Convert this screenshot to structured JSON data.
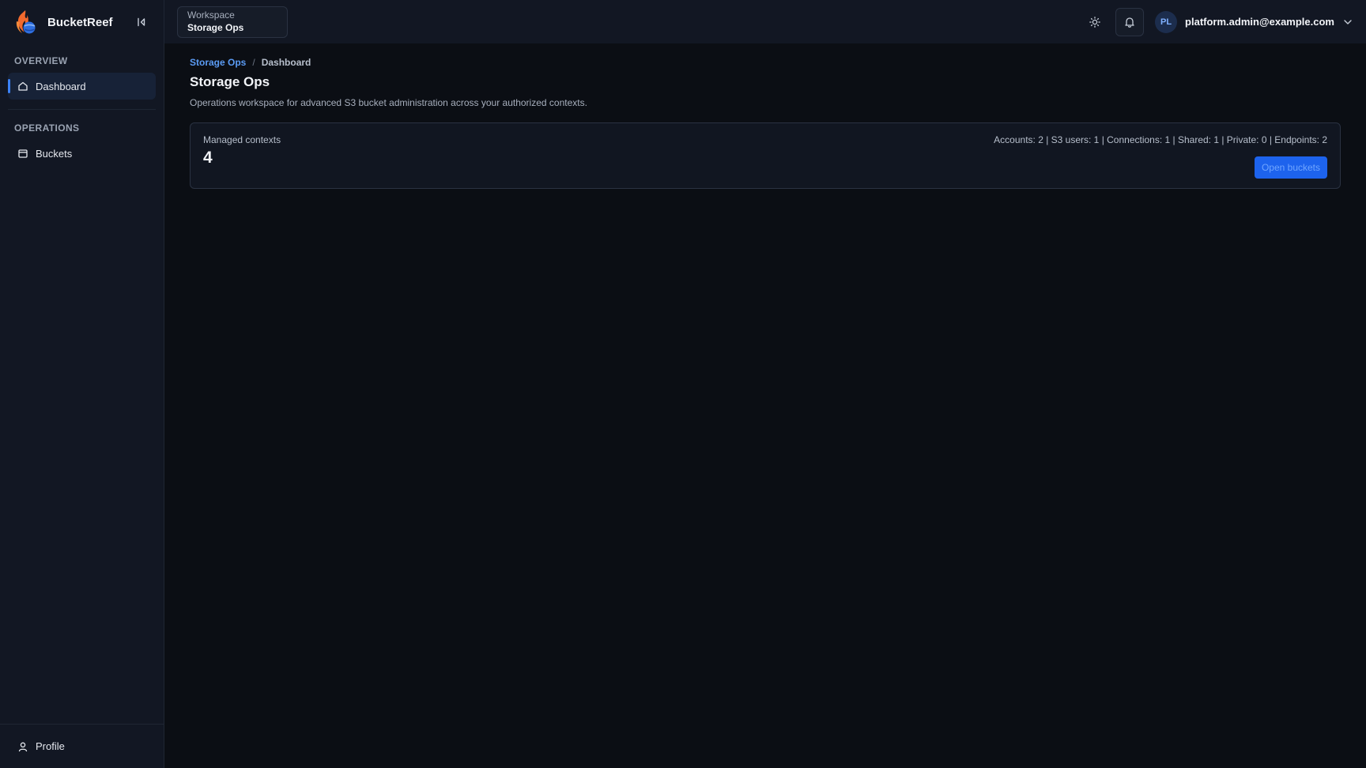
{
  "app": {
    "name": "BucketReef"
  },
  "sidebar": {
    "sections": [
      {
        "label": "OVERVIEW",
        "items": [
          {
            "label": "Dashboard",
            "icon": "home-icon",
            "active": true
          }
        ]
      },
      {
        "label": "OPERATIONS",
        "items": [
          {
            "label": "Buckets",
            "icon": "bucket-icon",
            "active": false
          }
        ]
      }
    ],
    "footer": {
      "label": "Profile",
      "icon": "user-icon"
    }
  },
  "topbar": {
    "workspace": {
      "label": "Workspace",
      "value": "Storage Ops"
    },
    "user": {
      "initials": "PL",
      "email": "platform.admin@example.com"
    }
  },
  "breadcrumb": {
    "parent": "Storage Ops",
    "separator": "/",
    "current": "Dashboard"
  },
  "page": {
    "title": "Storage Ops",
    "description": "Operations workspace for advanced S3 bucket administration across your authorized contexts."
  },
  "card": {
    "label": "Managed contexts",
    "value": "4",
    "stats": "Accounts: 2 | S3 users: 1 | Connections: 1 | Shared: 1 | Private: 0 | Endpoints: 2",
    "button_label": "Open buckets"
  },
  "colors": {
    "accent": "#3b82f6",
    "button": "#1d63ed",
    "link": "#5b9cf5",
    "background": "#0b0e14",
    "sidebar": "#121723"
  }
}
